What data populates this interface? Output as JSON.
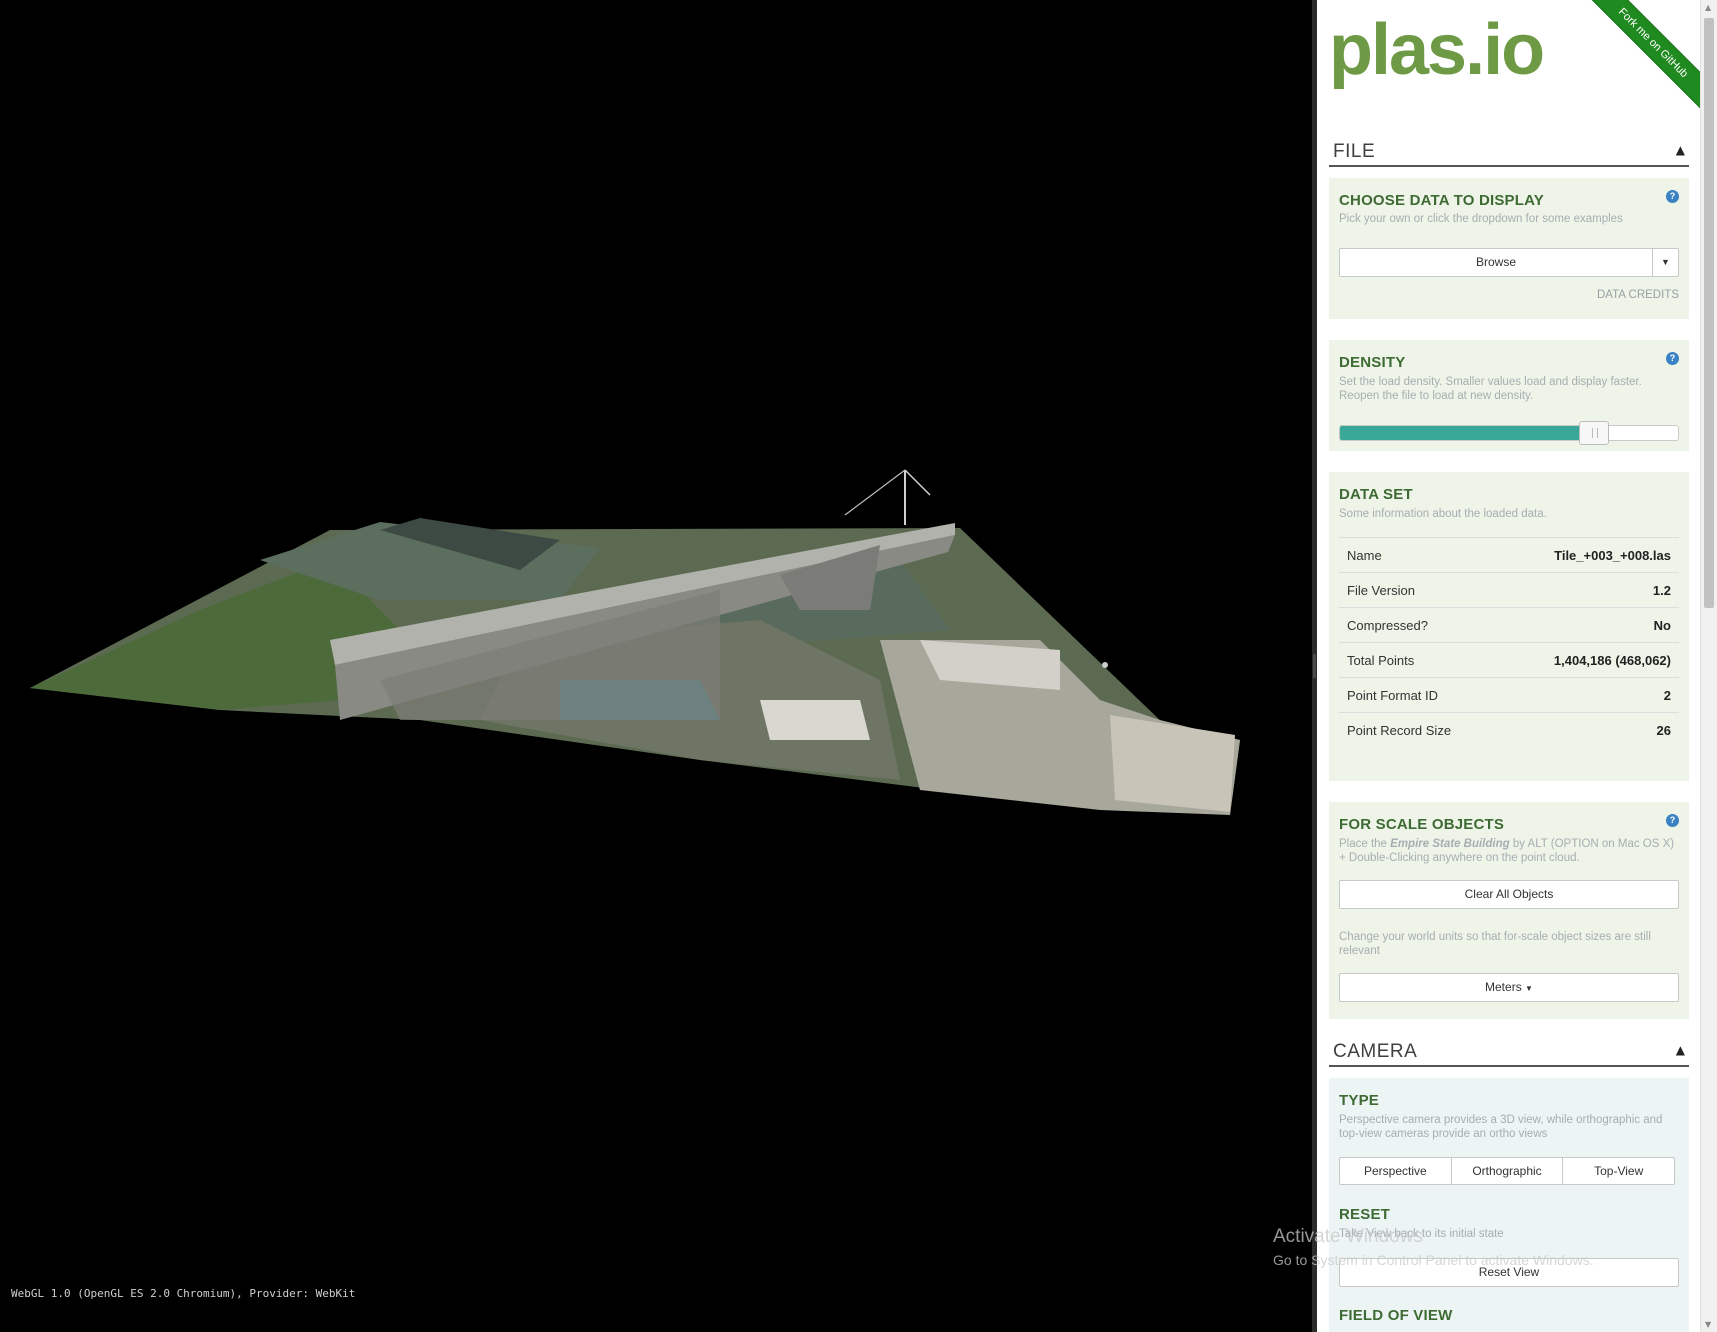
{
  "viewport": {
    "webgl_info": "WebGL 1.0 (OpenGL ES 2.0 Chromium), Provider: WebKit"
  },
  "header": {
    "logo": "plas.io",
    "ribbon": "Fork me on GitHub"
  },
  "file_section": {
    "title": "FILE",
    "choose": {
      "title": "CHOOSE DATA TO DISPLAY",
      "desc": "Pick your own or click the dropdown for some examples",
      "browse_label": "Browse",
      "credits": "DATA CREDITS"
    },
    "density": {
      "title": "DENSITY",
      "desc": "Set the load density. Smaller values load and display faster. Reopen the file to load at new density.",
      "value_fraction": 0.75
    },
    "dataset": {
      "title": "DATA SET",
      "desc": "Some information about the loaded data.",
      "rows": [
        {
          "key": "Name",
          "value": "Tile_+003_+008.las"
        },
        {
          "key": "File Version",
          "value": "1.2"
        },
        {
          "key": "Compressed?",
          "value": "No"
        },
        {
          "key": "Total Points",
          "value": "1,404,186 (468,062)"
        },
        {
          "key": "Point Format ID",
          "value": "2"
        },
        {
          "key": "Point Record Size",
          "value": "26"
        }
      ]
    },
    "scale": {
      "title": "FOR SCALE OBJECTS",
      "desc_pre": "Place the ",
      "desc_em": "Empire State Building",
      "desc_post": " by ALT (OPTION on Mac OS X) + Double-Clicking anywhere on the point cloud.",
      "clear_label": "Clear All Objects",
      "units_desc": "Change your world units so that for-scale object sizes are still relevant",
      "units_label": "Meters"
    }
  },
  "camera_section": {
    "title": "CAMERA",
    "type": {
      "title": "TYPE",
      "desc": "Perspective camera provides a 3D view, while orthographic and top-view cameras provide an ortho views",
      "options": [
        "Perspective",
        "Orthographic",
        "Top-View"
      ]
    },
    "reset": {
      "title": "RESET",
      "desc": "Take View back to its initial state",
      "button_label": "Reset View"
    },
    "fov": {
      "title": "FIELD OF VIEW"
    }
  },
  "watermark": {
    "line1": "Activate Windows",
    "line2": "Go to System in Control Panel to activate Windows."
  }
}
